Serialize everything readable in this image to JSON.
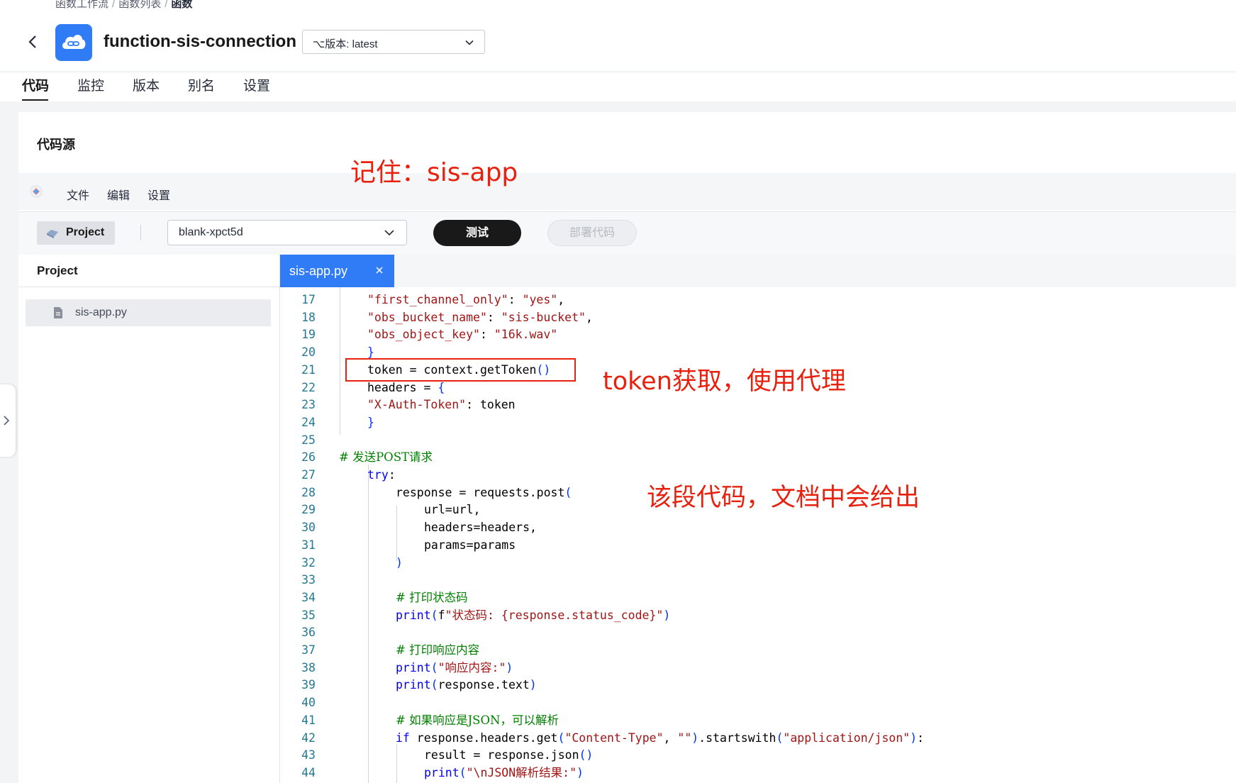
{
  "breadcrumb": {
    "items": [
      "函数工作流",
      "函数列表",
      "函数"
    ]
  },
  "function": {
    "name": "function-sis-connection",
    "version_label": "版本: latest"
  },
  "tabs": [
    "代码",
    "监控",
    "版本",
    "别名",
    "设置"
  ],
  "active_tab": "代码",
  "section": {
    "title": "代码源"
  },
  "annotations": {
    "remember": "记住：sis-app",
    "token": "token获取，使用代理",
    "docs": "该段代码，文档中会给出"
  },
  "ide": {
    "menu": [
      "文件",
      "编辑",
      "设置"
    ],
    "project_button": "Project",
    "env_select": "blank-xpct5d",
    "test_button": "测试",
    "deploy_button": "部署代码"
  },
  "project_panel": {
    "title": "Project",
    "files": [
      "sis-app.py"
    ]
  },
  "editor": {
    "open_tab": "sis-app.py",
    "lines": [
      {
        "n": "17",
        "segments": [
          [
            "s",
            "\"first_channel_only\""
          ],
          [
            "t",
            ": "
          ],
          [
            "s",
            "\"yes\""
          ],
          [
            "t",
            ","
          ]
        ]
      },
      {
        "n": "18",
        "segments": [
          [
            "s",
            "\"obs_bucket_name\""
          ],
          [
            "t",
            ": "
          ],
          [
            "s",
            "\"sis-bucket\""
          ],
          [
            "t",
            ","
          ]
        ]
      },
      {
        "n": "19",
        "segments": [
          [
            "s",
            "\"obs_object_key\""
          ],
          [
            "t",
            ": "
          ],
          [
            "s",
            "\"16k.wav\""
          ]
        ]
      },
      {
        "n": "20",
        "segments": [
          [
            "b",
            "}"
          ]
        ]
      },
      {
        "n": "21",
        "segments": [
          [
            "t",
            "token = context.getToken"
          ],
          [
            "b",
            "()"
          ]
        ]
      },
      {
        "n": "22",
        "segments": [
          [
            "t",
            "headers = "
          ],
          [
            "b",
            "{"
          ]
        ]
      },
      {
        "n": "23",
        "segments": [
          [
            "s",
            "\"X-Auth-Token\""
          ],
          [
            "t",
            ": token"
          ]
        ]
      },
      {
        "n": "24",
        "segments": [
          [
            "b",
            "}"
          ]
        ]
      },
      {
        "n": "25",
        "segments": []
      },
      {
        "n": "26",
        "segments": [
          [
            "c",
            "# 发送POST请求"
          ]
        ]
      },
      {
        "n": "27",
        "segments": [
          [
            "k",
            "try"
          ],
          [
            "t",
            ":"
          ]
        ]
      },
      {
        "n": "28",
        "segments": [
          [
            "t",
            "response = requests.post"
          ],
          [
            "b",
            "("
          ]
        ]
      },
      {
        "n": "29",
        "segments": [
          [
            "t",
            "url=url,"
          ]
        ]
      },
      {
        "n": "30",
        "segments": [
          [
            "t",
            "headers=headers,"
          ]
        ]
      },
      {
        "n": "31",
        "segments": [
          [
            "t",
            "params=params"
          ]
        ]
      },
      {
        "n": "32",
        "segments": [
          [
            "b",
            ")"
          ]
        ]
      },
      {
        "n": "33",
        "segments": []
      },
      {
        "n": "34",
        "segments": [
          [
            "c",
            "# 打印状态码"
          ]
        ]
      },
      {
        "n": "35",
        "segments": [
          [
            "k",
            "print"
          ],
          [
            "b",
            "("
          ],
          [
            "t",
            "f"
          ],
          [
            "s",
            "\"状态码: {response.status_code}\""
          ],
          [
            "b",
            ")"
          ]
        ]
      },
      {
        "n": "36",
        "segments": []
      },
      {
        "n": "37",
        "segments": [
          [
            "c",
            "# 打印响应内容"
          ]
        ]
      },
      {
        "n": "38",
        "segments": [
          [
            "k",
            "print"
          ],
          [
            "b",
            "("
          ],
          [
            "s",
            "\"响应内容:\""
          ],
          [
            "b",
            ")"
          ]
        ]
      },
      {
        "n": "39",
        "segments": [
          [
            "k",
            "print"
          ],
          [
            "b",
            "("
          ],
          [
            "t",
            "response.text"
          ],
          [
            "b",
            ")"
          ]
        ]
      },
      {
        "n": "40",
        "segments": []
      },
      {
        "n": "41",
        "segments": [
          [
            "c",
            "# 如果响应是JSON，可以解析"
          ]
        ]
      },
      {
        "n": "42",
        "segments": [
          [
            "k",
            "if"
          ],
          [
            "t",
            " response.headers.get"
          ],
          [
            "b",
            "("
          ],
          [
            "s",
            "\"Content-Type\""
          ],
          [
            "t",
            ", "
          ],
          [
            "s",
            "\"\""
          ],
          [
            "b",
            ")"
          ],
          [
            "t",
            ".startswith"
          ],
          [
            "b",
            "("
          ],
          [
            "s",
            "\"application/json\""
          ],
          [
            "b",
            ")"
          ],
          [
            "t",
            ":"
          ]
        ]
      },
      {
        "n": "43",
        "segments": [
          [
            "t",
            "result = response.json"
          ],
          [
            "b",
            "()"
          ]
        ]
      },
      {
        "n": "44",
        "segments": [
          [
            "k",
            "print"
          ],
          [
            "b",
            "("
          ],
          [
            "s",
            "\"\\nJSON解析结果:\""
          ],
          [
            "b",
            ")"
          ]
        ]
      }
    ]
  },
  "colors": {
    "accent": "#2f7cf6",
    "annotation": "#e8210f",
    "primary_button": "#191919"
  },
  "icons": {
    "back": "chevron-left-icon",
    "function_logo": "cloud-link-icon",
    "version": "branch-icon",
    "file": "document-icon"
  }
}
